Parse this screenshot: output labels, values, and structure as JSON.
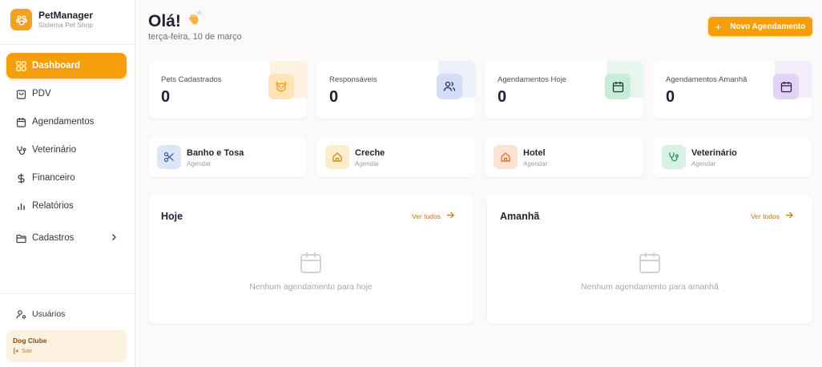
{
  "brand": {
    "name": "PetManager",
    "subtitle": "Sistema Pet Shop"
  },
  "nav": {
    "items": [
      {
        "label": "Dashboard",
        "icon": "grid-icon",
        "active": true
      },
      {
        "label": "PDV",
        "icon": "shopping-bag-icon"
      },
      {
        "label": "Agendamentos",
        "icon": "calendar-icon"
      },
      {
        "label": "Veterinário",
        "icon": "stethoscope-icon"
      },
      {
        "label": "Financeiro",
        "icon": "dollar-icon"
      },
      {
        "label": "Relatórios",
        "icon": "bar-chart-icon"
      },
      {
        "label": "Cadastros",
        "icon": "folder-icon",
        "chevron": true
      }
    ],
    "users_label": "Usuários"
  },
  "store": {
    "name": "Dog Clube",
    "logout_label": "Sair"
  },
  "header": {
    "greeting": "Olá!",
    "date": "terça-feira, 10 de março",
    "new_button_label": "Novo Agendamento"
  },
  "stats": [
    {
      "label": "Pets Cadastrados",
      "value": "0",
      "icon": "dog-face-icon",
      "color": "#f59e0b",
      "bg": "#fde9cc"
    },
    {
      "label": "Responsáveis",
      "value": "0",
      "icon": "users-icon",
      "color": "#3b4a78",
      "bg": "#dbe3f7"
    },
    {
      "label": "Agendamentos Hoje",
      "value": "0",
      "icon": "calendar-icon",
      "color": "#1f5c43",
      "bg": "#d4efe2"
    },
    {
      "label": "Agendamentos Amanhã",
      "value": "0",
      "icon": "calendar-icon",
      "color": "#4b3378",
      "bg": "#e9dcf8"
    }
  ],
  "services": [
    {
      "name": "Banho e Tosa",
      "sub": "Agendar",
      "icon": "scissors-icon",
      "color": "#3b5b9a",
      "bg": "#dde6f7"
    },
    {
      "name": "Creche",
      "sub": "Agendar",
      "icon": "home-icon",
      "color": "#c48a10",
      "bg": "#fbeccc"
    },
    {
      "name": "Hotel",
      "sub": "Agendar",
      "icon": "home-icon",
      "color": "#d9662a",
      "bg": "#fde3d2"
    },
    {
      "name": "Veterinário",
      "sub": "Agendar",
      "icon": "stethoscope-icon",
      "color": "#1f8a5a",
      "bg": "#d6f2e4"
    }
  ],
  "panels": [
    {
      "title": "Hoje",
      "link": "Ver todos",
      "empty": "Nenhum agendamento para hoje"
    },
    {
      "title": "Amanhã",
      "link": "Ver todos",
      "empty": "Nenhum agendamento para amanhã"
    }
  ],
  "colors": {
    "accent": "#f59e0b",
    "accent_text": "#c27410"
  }
}
